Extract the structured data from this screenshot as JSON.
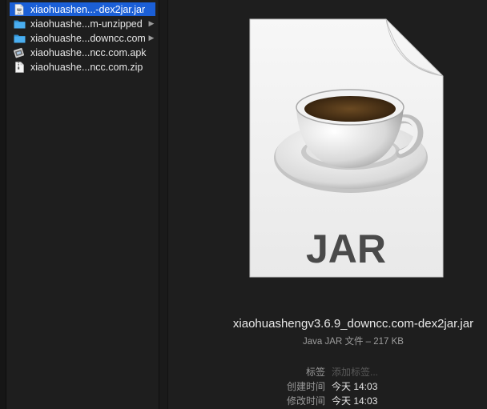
{
  "files": [
    {
      "name": "xiaohuashen...-dex2jar.jar",
      "icon": "jar-file-icon",
      "selected": true,
      "has_children": false
    },
    {
      "name": "xiaohuashe...m-unzipped",
      "icon": "folder-icon",
      "selected": false,
      "has_children": true
    },
    {
      "name": "xiaohuashe...downcc.com",
      "icon": "folder-icon",
      "selected": false,
      "has_children": true
    },
    {
      "name": "xiaohuashe...ncc.com.apk",
      "icon": "apk-file-icon",
      "selected": false,
      "has_children": false
    },
    {
      "name": "xiaohuashe...ncc.com.zip",
      "icon": "zip-file-icon",
      "selected": false,
      "has_children": false
    }
  ],
  "preview": {
    "icon_label": "JAR",
    "filename": "xiaohuashengv3.6.9_downcc.com-dex2jar.jar",
    "kind": "Java JAR 文件 – 217 KB",
    "meta": {
      "tags_label": "标签",
      "tags_placeholder": "添加标签...",
      "created_label": "创建时间",
      "created_value": "今天 14:03",
      "modified_label": "修改时间",
      "modified_value": "今天 14:03"
    }
  },
  "colors": {
    "selection": "#1b5fd6",
    "folder": "#3aa1e0",
    "background": "#1e1e1e"
  }
}
